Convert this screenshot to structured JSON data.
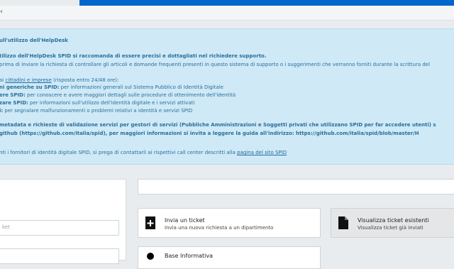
{
  "header": {
    "chevron": "‹"
  },
  "info_box": {
    "title": "ull'utilizzo dell'HelpDesk",
    "intro": "tilizzo dell'HelpDesk SPID si raccomanda di essere precisi e dottagliati nel richiedere supporto.",
    "advice": " prima di inviare la richiesta di controllare gli articoli e domande frequenti presenti in questo sistema di supporto o i suggerimenti che verranno forniti durante la scrittura del",
    "citizens_prefix": " ai ",
    "citizens_link": "cittadini e imprese",
    "citizens_suffix": " (risposta entro 24/48 ore):",
    "item1_b": "ni generiche su SPID:",
    "item1_t": " per informazioni generali sul Sistema Pubblico di Identità Digitale",
    "item2_b": "ere SPID:",
    "item2_t": " per conoscere e avere maggiori dettagli sulle procedure di ottenimento dell'identità",
    "item3_b": "zare SPID:",
    "item3_t": " per informazioni sull'utilizzo dell'identità digitale e i servizi attivati",
    "item4_b": "i:",
    "item4_t": " per segnalare malfunzionamenti o problemi relativi a identità e servizi SPID",
    "meta_line": " metadata e richieste di validazione servizi per gestori di servizi (Pubbliche Amministrazioni e Soggetti privati che utilizzano SPID per far accedere utenti) s",
    "github_line": "github (https://github.com/italia/spid), per maggiori informazioni si invita a leggere la guida all'indirizzo: https://github.com/italia/spid/blob/master/H",
    "providers_prefix": "nti i fornitori di identità digitale SPID, si prega di contattarli ai rispettivi call center descritti alla ",
    "providers_link": "pagina del sito SPID"
  },
  "left_input": {
    "placeholder": "ket"
  },
  "cards": {
    "send_ticket": {
      "title": "Invia un ticket",
      "subtitle": "Invia una nuova richiesta a un dipartimento"
    },
    "view_tickets": {
      "title": "Visualizza ticket esistenti",
      "subtitle": "Visualizza ticket già inviati"
    },
    "base_info": {
      "title": "Base Informativa"
    }
  }
}
